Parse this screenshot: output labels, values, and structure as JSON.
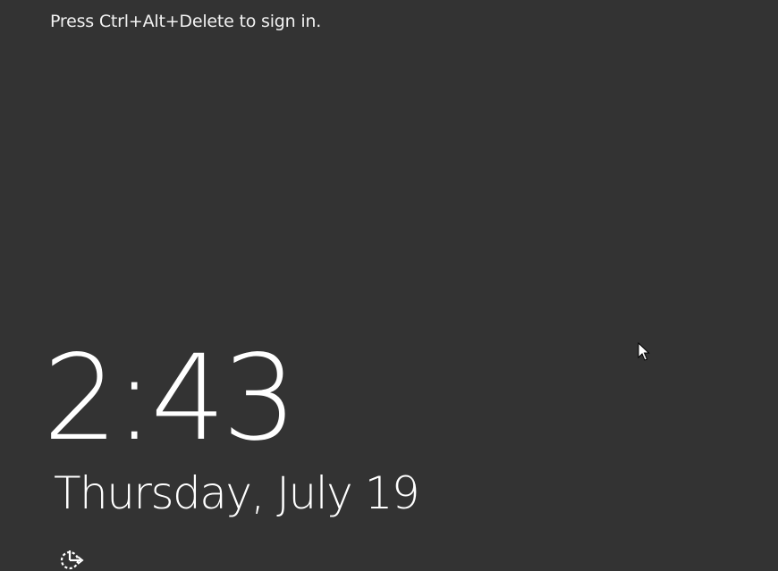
{
  "lock_screen": {
    "prompt": "Press Ctrl+Alt+Delete to sign in.",
    "time": "2:43",
    "date": "Thursday, July 19",
    "ease_of_access_icon": "ease-of-access-icon",
    "cursor_icon": "mouse-pointer-icon"
  },
  "colors": {
    "background": "#333333",
    "text": "#ffffff"
  }
}
